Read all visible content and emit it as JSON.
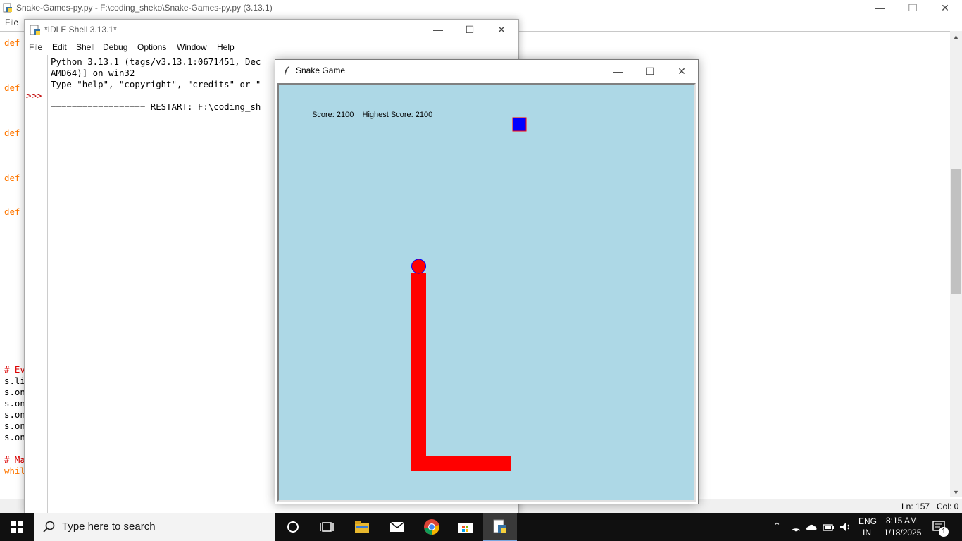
{
  "editor": {
    "title": "Snake-Games-py.py - F:\\coding_sheko\\Snake-Games-py.py (3.13.1)",
    "menu": [
      "File"
    ],
    "code_lines": [
      {
        "text": "def",
        "style": "kw"
      },
      {
        "text": "def",
        "style": "kw"
      },
      {
        "text": "def",
        "style": "kw"
      },
      {
        "text": "def",
        "style": "kw"
      },
      {
        "text": "def",
        "style": "kw"
      },
      {
        "text": "# Ev",
        "style": "cm"
      },
      {
        "text": "s.li",
        "style": "plain"
      },
      {
        "text": "s.on",
        "style": "plain"
      },
      {
        "text": "s.on",
        "style": "plain"
      },
      {
        "text": "s.on",
        "style": "plain"
      },
      {
        "text": "s.on",
        "style": "plain"
      },
      {
        "text": "s.on",
        "style": "plain"
      },
      {
        "text": "# Ma",
        "style": "cm"
      },
      {
        "text": "whil",
        "style": "kw"
      }
    ],
    "status": {
      "line": "Ln: 157",
      "col": "Col: 0"
    }
  },
  "shell": {
    "title": "*IDLE Shell 3.13.1*",
    "menu": [
      "File",
      "Edit",
      "Shell",
      "Debug",
      "Options",
      "Window",
      "Help"
    ],
    "prompt": ">>>",
    "lines": [
      "Python 3.13.1 (tags/v3.13.1:0671451, Dec",
      "AMD64)] on win32",
      "Type \"help\", \"copyright\", \"credits\" or \"",
      "",
      "================== RESTART: F:\\coding_sh"
    ]
  },
  "snake_game": {
    "title": "Snake Game",
    "score_text": "Score: 2100    Highest Score: 2100",
    "colors": {
      "background": "#add8e6",
      "snake": "#ff0000",
      "head_outline": "#0000ff",
      "food": "#0000ff",
      "food_outline": "#ff0000"
    }
  },
  "taskbar": {
    "search_placeholder": "Type here to search",
    "language": "ENG",
    "region": "IN",
    "time": "8:15 AM",
    "date": "1/18/2025",
    "notification_count": "1",
    "apps": [
      "cortana-icon",
      "task-view-icon",
      "file-explorer-icon",
      "mail-icon",
      "chrome-icon",
      "store-icon",
      "python-idle-icon"
    ]
  }
}
